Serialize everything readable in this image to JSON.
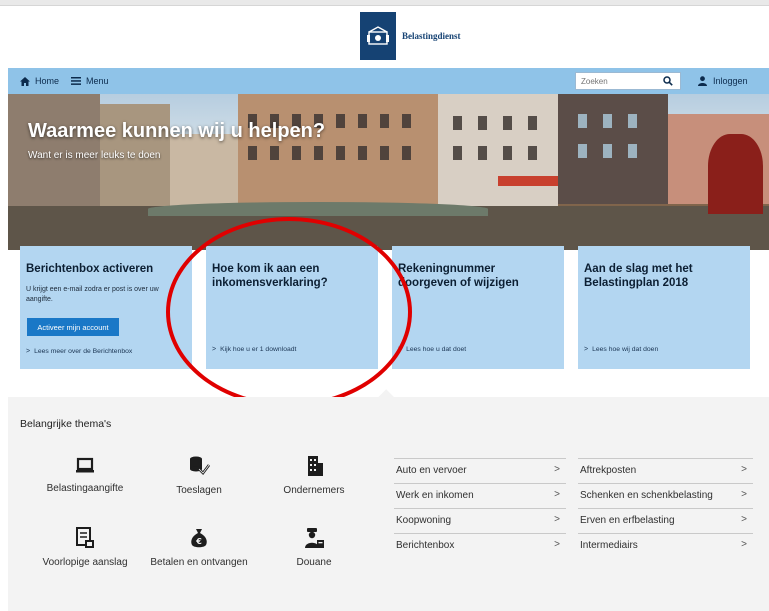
{
  "header": {
    "brand": "Belastingdienst"
  },
  "nav": {
    "home_label": "Home",
    "menu_label": "Menu",
    "search_placeholder": "Zoeken",
    "login_label": "Inloggen"
  },
  "hero": {
    "title": "Waarmee kunnen wij u helpen?",
    "subtitle": "Want er is meer leuks te doen"
  },
  "cards": [
    {
      "title": "Berichtenbox activeren",
      "text": "U krijgt een e-mail zodra er post is over uw aangifte.",
      "button": "Activeer mijn account",
      "link": "Lees meer over de Berichtenbox"
    },
    {
      "title": "Hoe kom ik aan een inkomensverklaring?",
      "link": "Kijk hoe u er 1 downloadt"
    },
    {
      "title": "Rekeningnummer doorgeven of wijzigen",
      "link": "Lees hoe u dat doet"
    },
    {
      "title": "Aan de slag met het Belastingplan 2018",
      "link": "Lees hoe wij dat doen"
    }
  ],
  "themes": {
    "title": "Belangrijke thema's",
    "items": [
      {
        "label": "Belastingaangifte",
        "icon": "laptop-icon"
      },
      {
        "label": "Toeslagen",
        "icon": "coins-check-icon"
      },
      {
        "label": "Ondernemers",
        "icon": "building-icon"
      },
      {
        "label": "Voorlopige aanslag",
        "icon": "document-calendar-icon"
      },
      {
        "label": "Betalen en ontvangen",
        "icon": "money-bag-icon"
      },
      {
        "label": "Douane",
        "icon": "customs-officer-icon"
      }
    ]
  },
  "links_col1": [
    "Auto en vervoer",
    "Werk en inkomen",
    "Koopwoning",
    "Berichtenbox"
  ],
  "links_col2": [
    "Aftrekposten",
    "Schenken en schenkbelasting",
    "Erven en erfbelasting",
    "Intermediairs"
  ],
  "chevron": ">",
  "colors": {
    "navbar": "#8fc3e8",
    "card": "#b3d6f1",
    "button": "#1a78c7",
    "highlight_circle": "#e00000",
    "brand": "#154273"
  }
}
